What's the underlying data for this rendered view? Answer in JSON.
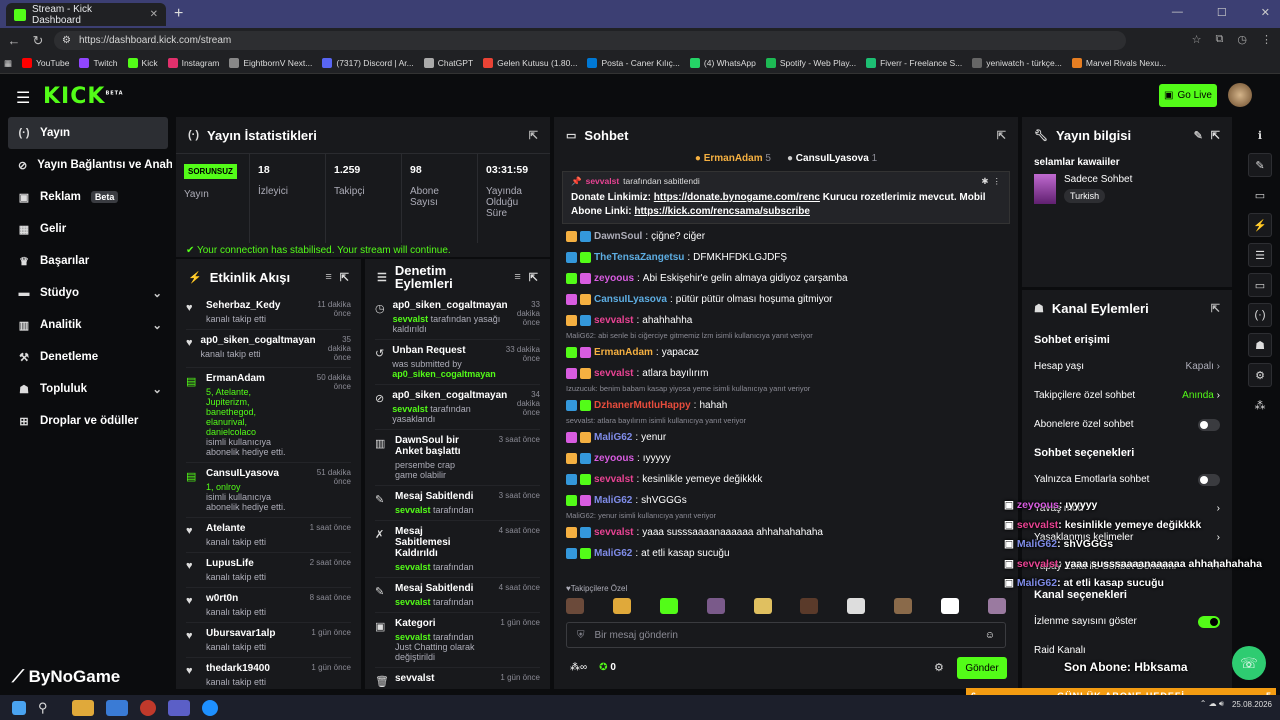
{
  "browser": {
    "tab_title": "Stream - Kick Dashboard",
    "url": "https://dashboard.kick.com/stream"
  },
  "bookmarks": [
    "YouTube",
    "Twitch",
    "Kick",
    "Instagram",
    "EightbornV Next...",
    "(7317) Discord | Ar...",
    "ChatGPT",
    "Gelen Kutusu (1.80...",
    "Posta - Caner Kılıç...",
    "(4) WhatsApp",
    "Spotify - Web Play...",
    "Fiverr - Freelance S...",
    "yeniwatch - türkçe...",
    "Marvel Rivals Nexu..."
  ],
  "header": {
    "logo": "KICK",
    "logo_badge": "BETA",
    "go_live": "Go Live"
  },
  "sidebar": {
    "items": [
      {
        "label": "Yayın",
        "icon": "broadcast-icon",
        "active": true
      },
      {
        "label": "Yayın Bağlantısı ve Anahtarı",
        "icon": "link-icon"
      },
      {
        "label": "Reklam",
        "icon": "ad-icon",
        "badge": "Beta"
      },
      {
        "label": "Gelir",
        "icon": "revenue-icon"
      },
      {
        "label": "Başarılar",
        "icon": "trophy-icon"
      },
      {
        "label": "Stüdyo",
        "icon": "studio-icon",
        "chevron": true
      },
      {
        "label": "Analitik",
        "icon": "analytics-icon",
        "chevron": true
      },
      {
        "label": "Denetleme",
        "icon": "hammer-icon"
      },
      {
        "label": "Topluluk",
        "icon": "community-icon",
        "chevron": true
      },
      {
        "label": "Droplar ve ödüller",
        "icon": "gift-icon"
      }
    ],
    "watermark": "ByNoGame"
  },
  "stats": {
    "title": "Yayın İstatistikleri",
    "status": "SORUNSUZ",
    "status_label": "Yayın",
    "items": [
      {
        "value": "18",
        "label": "İzleyici"
      },
      {
        "value": "1.259",
        "label": "Takipçi"
      },
      {
        "value": "98",
        "label": "Abone Sayısı"
      },
      {
        "value": "03:31:59",
        "label": "Yayında Olduğu Süre"
      }
    ],
    "connection": "Your connection has stabilised. Your stream will continue."
  },
  "activity": {
    "title": "Etkinlik Akışı",
    "rows": [
      {
        "name": "Seherbaz_Kedy",
        "time": "11 dakika önce",
        "desc": "kanalı takip etti",
        "icon": "heart"
      },
      {
        "name": "ap0_siken_cogaltmayan",
        "time": "35 dakika önce",
        "desc": "kanalı takip etti",
        "icon": "heart"
      },
      {
        "name": "ErmanAdam",
        "time": "50 dakika önce",
        "hl": "5, Atelante, Jupiterizm, banethegod, elanurival, danielcolaco",
        "desc": "isimli kullanıcıya abonelik hediye etti.",
        "icon": "gift"
      },
      {
        "name": "CansuILyasova",
        "time": "51 dakika önce",
        "hl": "1, onlroy",
        "desc": "isimli kullanıcıya abonelik hediye etti.",
        "icon": "gift"
      },
      {
        "name": "Atelante",
        "time": "1 saat önce",
        "desc": "kanalı takip etti",
        "icon": "heart"
      },
      {
        "name": "LupusLife",
        "time": "2 saat önce",
        "desc": "kanalı takip etti",
        "icon": "heart"
      },
      {
        "name": "w0rt0n",
        "time": "8 saat önce",
        "desc": "kanalı takip etti",
        "icon": "heart"
      },
      {
        "name": "Ubursavar1alp",
        "time": "1 gün önce",
        "desc": "kanalı takip etti",
        "icon": "heart"
      },
      {
        "name": "thedark19400",
        "time": "1 gün önce",
        "desc": "kanalı takip etti",
        "icon": "heart"
      }
    ]
  },
  "moderation": {
    "title": "Denetim Eylemleri",
    "rows": [
      {
        "name": "ap0_siken_cogaltmayan",
        "time": "33 dakika önce",
        "user": "sevvalst",
        "desc": "tarafından yasağı kaldırıldı",
        "icon": "clock"
      },
      {
        "name": "Unban Request",
        "time": "33 dakika önce",
        "pre": "was submitted by",
        "user": "ap0_siken_cogaltmayan",
        "desc": "",
        "icon": "undo"
      },
      {
        "name": "ap0_siken_cogaltmayan",
        "time": "34 dakika önce",
        "user": "sevvalst",
        "desc": "tarafından yasaklandı",
        "icon": "ban"
      },
      {
        "name": "DawnSoul bir Anket başlattı",
        "time": "3 saat önce",
        "user": "",
        "desc": "persembe crap game olabilir",
        "icon": "poll"
      },
      {
        "name": "Mesaj Sabitlendi",
        "time": "3 saat önce",
        "user": "sevvalst",
        "desc": "tarafından",
        "icon": "pin"
      },
      {
        "name": "Mesaj Sabitlemesi Kaldırıldı",
        "time": "4 saat önce",
        "user": "sevvalst",
        "desc": "tarafından",
        "icon": "unpin"
      },
      {
        "name": "Mesaj Sabitlendi",
        "time": "4 saat önce",
        "user": "sevvalst",
        "desc": "tarafından",
        "icon": "pin"
      },
      {
        "name": "Kategori",
        "time": "1 gün önce",
        "user": "sevvalst",
        "desc": "tarafından Just Chatting olarak değiştirildi",
        "icon": "category"
      },
      {
        "name": "sevvalst",
        "time": "1 gün önce",
        "user": "",
        "desc": "",
        "icon": "trash"
      }
    ]
  },
  "chat": {
    "title": "Sohbet",
    "top_gifters": [
      {
        "name": "ErmanAdam",
        "count": "5"
      },
      {
        "name": "CansuILyasova",
        "count": "1"
      }
    ],
    "pinned": {
      "by": "sevvalst",
      "by_suffix": "tarafından sabitlendi",
      "text": "Donate Linkimiz:",
      "link1": "https://donate.bynogame.com/renc",
      "mid": "Kurucu rozetlerimiz mevcut. Mobil Abone Linki:",
      "link2": "https://kick.com/rencsama/subscribe"
    },
    "messages": [
      {
        "user": "DawnSoul",
        "color": "#adadb8",
        "text": "çiğne? ciğer"
      },
      {
        "user": "TheTensaZangetsu",
        "color": "#5dade2",
        "text": "DFMKHFDKLGJDFŞ"
      },
      {
        "user": "zeyoous",
        "color": "#d85ce0",
        "text": "Abi Eskişehir'e gelin almaya gidiyoz çarşamba"
      },
      {
        "user": "CansuILyasova",
        "color": "#5dade2",
        "text": "pütür pütür olması hoşuma gitmiyor"
      },
      {
        "user": "sevvalst",
        "color": "#e84393",
        "text": "ahahhahha"
      },
      {
        "reply": "MaliG62: abi senle bi ciğerciye gitmemiz lzm isimli kullanıcıya yanıt veriyor"
      },
      {
        "user": "ErmanAdam",
        "color": "#f5b041",
        "text": "yapacaz"
      },
      {
        "user": "sevvalst",
        "color": "#e84393",
        "text": "atlara bayılırım"
      },
      {
        "reply": "Izuzucuk: benim babam kasap yiyosa yeme isimli kullanıcıya yanıt veriyor"
      },
      {
        "user": "DzhanerMutluHappy",
        "color": "#e74c3c",
        "text": "hahah"
      },
      {
        "reply": "sevvalst: atlara bayılırım isimli kullanıcıya yanıt veriyor"
      },
      {
        "user": "MaliG62",
        "color": "#7f8ce8",
        "text": "yenur"
      },
      {
        "user": "zeyoous",
        "color": "#d85ce0",
        "text": "ıyyyyy"
      },
      {
        "user": "sevvalst",
        "color": "#e84393",
        "text": "kesinlikle yemeye değikkkk"
      },
      {
        "user": "MaliG62",
        "color": "#7f8ce8",
        "text": "shVGGGs"
      },
      {
        "reply": "MaliG62: yenur isimli kullanıcıya yanıt veriyor"
      },
      {
        "user": "sevvalst",
        "color": "#e84393",
        "text": "yaaa susssaaaanaaaaaa ahhahahahaha"
      },
      {
        "user": "MaliG62",
        "color": "#7f8ce8",
        "text": "at etli kasap sucuğu"
      }
    ],
    "featured_label": "Takipçilere Özel",
    "input_placeholder": "Bir mesaj gönderin",
    "points": "0",
    "send": "Gönder"
  },
  "stream_info": {
    "title": "Yayın bilgisi",
    "stream_title": "selamlar kawaiiler",
    "category": "Sadece Sohbet",
    "tag": "Turkish"
  },
  "channel_actions": {
    "title": "Kanal Eylemleri",
    "chat_access": "Sohbet erişimi",
    "rows": [
      {
        "label": "Hesap yaşı",
        "value": "Kapalı"
      },
      {
        "label": "Takipçilere özel sohbet",
        "value": "Anında"
      }
    ],
    "sub_only": "Abonelere özel sohbet",
    "chat_options": "Sohbet seçenekleri",
    "emote_only": "Yalnızca Emotlarla sohbet",
    "slow_mode": "Yavaş mod",
    "banned_words": "Yasaklanmış kelimeler",
    "ai_mod": "Yapay Zeka ile Sohbet Denetimi",
    "channel_options": "Kanal seçenekleri",
    "show_viewers": "İzlenme sayısını göster",
    "raid": "Raid Kanalı"
  },
  "overlay": {
    "chat": [
      {
        "user": "zeyoous",
        "text": ": ıyyyyy"
      },
      {
        "user": "sevvalst",
        "text": ": kesinlikle yemeye değikkkk"
      },
      {
        "user": "MaliG62",
        "text": ": shVGGGs"
      },
      {
        "user": "sevvalst",
        "text": ": yaaa susssaaaanaaaaaa ahhahahahaha"
      },
      {
        "user": "MaliG62",
        "text": ": at etli kasap sucuğu"
      }
    ],
    "last_sub": "Son Abone: Hbksama",
    "goal_left": "6",
    "goal_label": "GÜNLÜK ABONE HEDEFİ",
    "goal_right": "5"
  },
  "taskbar": {
    "date": "25.08.2026"
  }
}
